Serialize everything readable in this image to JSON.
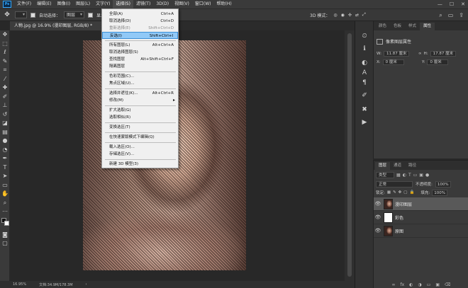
{
  "menubar": {
    "items": [
      "文件(F)",
      "编辑(E)",
      "图像(I)",
      "图层(L)",
      "文字(Y)",
      "选择(S)",
      "滤镜(T)",
      "3D(D)",
      "视图(V)",
      "窗口(W)",
      "帮助(H)"
    ],
    "active_index": 5,
    "window_controls": [
      "—",
      "☐",
      "✕"
    ]
  },
  "optionsbar": {
    "auto_select_label": "自动选择：",
    "auto_select_value": "图层",
    "show_transform_label": "显示变换控件",
    "mode_3d_label": "3D 模式："
  },
  "document_tab": {
    "title": "人物.jpg @ 16.9% (漫印图层, RGB/8) *",
    "close": "×"
  },
  "select_menu": {
    "items": [
      {
        "label": "全部(A)",
        "shortcut": "Ctrl+A"
      },
      {
        "label": "取消选择(D)",
        "shortcut": "Ctrl+D"
      },
      {
        "label": "重新选择(E)",
        "shortcut": "Shift+Ctrl+D",
        "disabled": true
      },
      {
        "label": "反选(I)",
        "shortcut": "Shift+Ctrl+I",
        "highlighted": true
      },
      {
        "label": "所有图层(L)",
        "shortcut": "Alt+Ctrl+A"
      },
      {
        "label": "取消选择图层(S)",
        "shortcut": ""
      },
      {
        "label": "查找图层",
        "shortcut": "Alt+Shift+Ctrl+F"
      },
      {
        "label": "隔离图层",
        "shortcut": ""
      },
      {
        "label": "色彩范围(C)...",
        "shortcut": ""
      },
      {
        "label": "焦点区域(U)...",
        "shortcut": ""
      },
      {
        "label": "选择并遮住(K)...",
        "shortcut": "Alt+Ctrl+R"
      },
      {
        "label": "修改(M)",
        "shortcut": "",
        "submenu": true
      },
      {
        "label": "扩大选取(G)",
        "shortcut": ""
      },
      {
        "label": "选取相似(R)",
        "shortcut": ""
      },
      {
        "label": "变换选区(T)",
        "shortcut": ""
      },
      {
        "label": "在快速蒙版模式下编辑(Q)",
        "shortcut": ""
      },
      {
        "label": "载入选区(O)...",
        "shortcut": ""
      },
      {
        "label": "存储选区(V)...",
        "shortcut": ""
      },
      {
        "label": "新建 3D 模型(3)",
        "shortcut": ""
      }
    ]
  },
  "properties_panel": {
    "tabs": [
      "颜色",
      "色板",
      "样式",
      "属性"
    ],
    "active_tab": 3,
    "title": "像素图层属性",
    "w_label": "W:",
    "w_value": "11.87 厘米",
    "h_label": "H:",
    "h_value": "17.87 厘米",
    "x_label": "X:",
    "x_value": "0 厘米",
    "y_label": "Y:",
    "y_value": "0 厘米",
    "link_icon": "∞"
  },
  "layers_panel": {
    "tabs": [
      "图层",
      "通道",
      "路径"
    ],
    "active_tab": 0,
    "filter_value": "类型",
    "blend_mode": "正常",
    "opacity_label": "不透明度:",
    "opacity_value": "100%",
    "lock_label": "锁定:",
    "fill_label": "填充:",
    "fill_value": "100%",
    "layers": [
      {
        "name": "漫印图层",
        "thumb": "photo",
        "selected": true
      },
      {
        "name": "彩色",
        "thumb": "blank",
        "selected": false
      },
      {
        "name": "原图",
        "thumb": "photo",
        "selected": false
      }
    ],
    "bottom_icons": [
      "fx",
      "◐",
      "◑",
      "▭",
      "▣",
      "⌫"
    ]
  },
  "statusbar": {
    "zoom": "16.95%",
    "doc_info": "文档:34.9M/178.3M",
    "arrow": "›"
  },
  "icons": {
    "tools": [
      "move-icon",
      "marquee-icon",
      "lasso-icon",
      "quick-select-icon",
      "crop-icon",
      "eyedropper-icon",
      "healing-icon",
      "brush-icon",
      "stamp-icon",
      "history-brush-icon",
      "eraser-icon",
      "gradient-icon",
      "blur-icon",
      "dodge-icon",
      "pen-icon",
      "type-icon",
      "path-select-icon",
      "rectangle-icon",
      "hand-icon",
      "zoom-icon",
      "more-icon"
    ]
  },
  "colors": {
    "highlight": "#91c9f7",
    "accent": "#31a8ff"
  }
}
